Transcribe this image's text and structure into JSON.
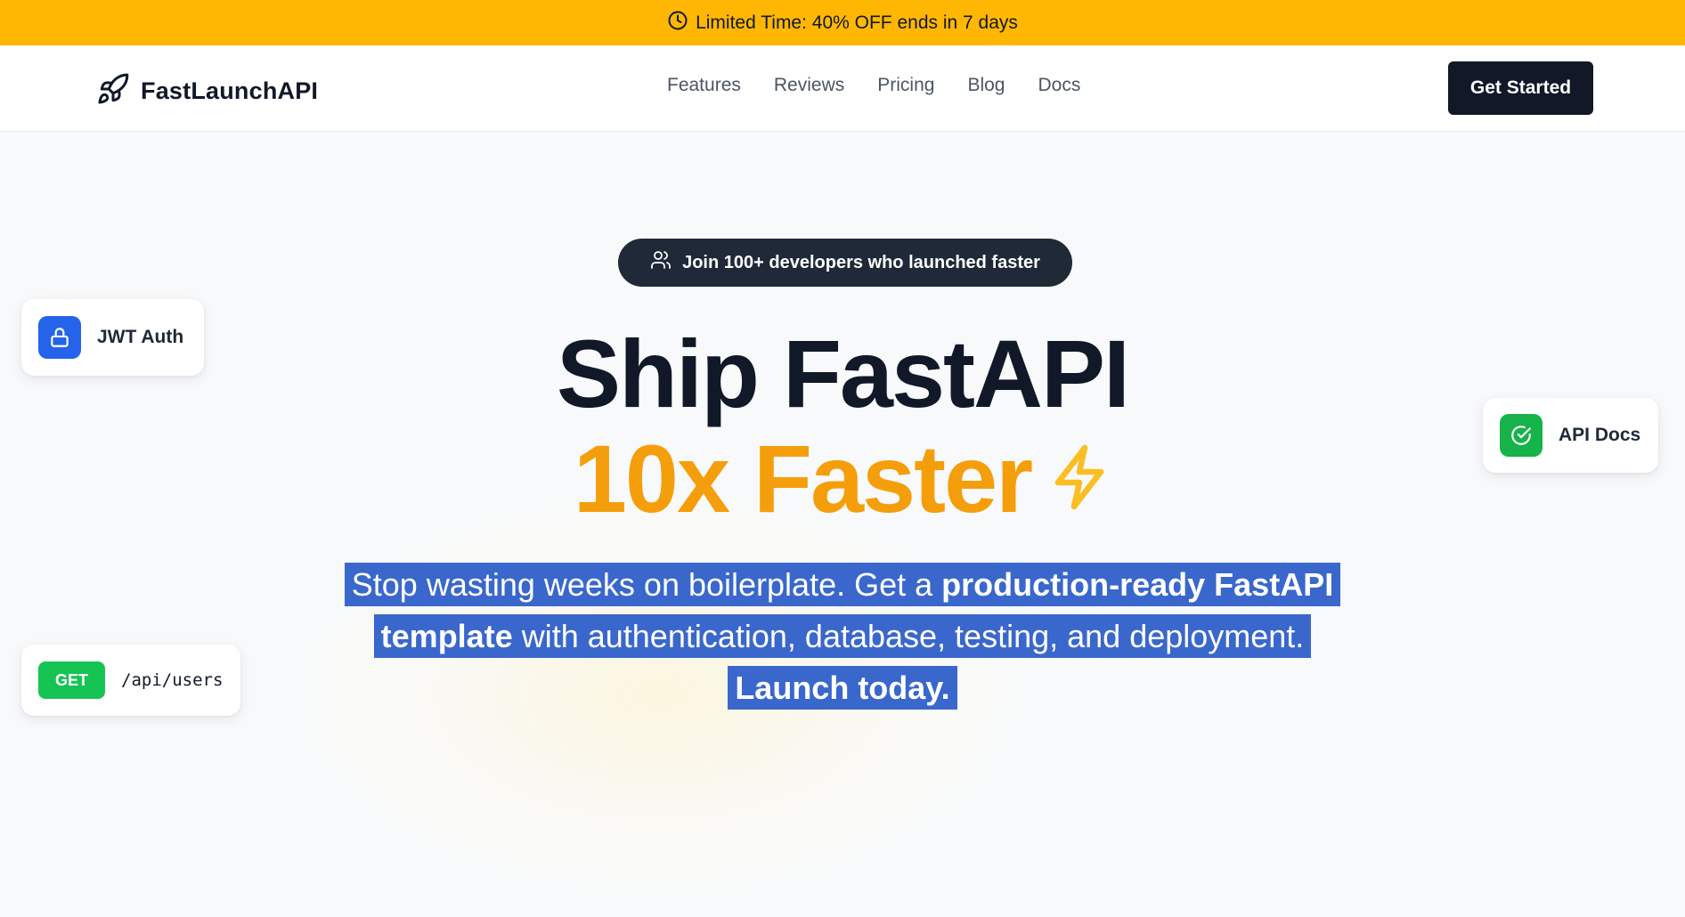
{
  "promo": {
    "icon": "clock-icon",
    "text": "Limited Time: 40% OFF ends in 7 days",
    "background": "#ffb703"
  },
  "nav": {
    "brand_icon": "rocket-icon",
    "brand_name": "FastLaunchAPI",
    "links": [
      "Features",
      "Reviews",
      "Pricing",
      "Blog",
      "Docs"
    ],
    "cta_label": "Get Started"
  },
  "hero": {
    "pill_icon": "users-icon",
    "pill_text": "Join 100+ developers who launched faster",
    "headline_line1": "Ship FastAPI",
    "headline_line2": "10x Faster",
    "headline_icon": "lightning-icon",
    "subtitle": {
      "part1": "Stop wasting weeks on boilerplate. Get a ",
      "bold1": "production-ready FastAPI template",
      "part2": " with authentication, database, testing, and deployment. ",
      "bold2": "Launch today."
    },
    "selection_color": "#3a67cc",
    "accent_color": "#f59e0b"
  },
  "floating_cards": {
    "jwt": {
      "icon": "lock-icon",
      "label": "JWT Auth"
    },
    "docs": {
      "icon": "check-circle-icon",
      "label": "API Docs"
    },
    "endpoint": {
      "method": "GET",
      "path": "/api/users"
    }
  }
}
